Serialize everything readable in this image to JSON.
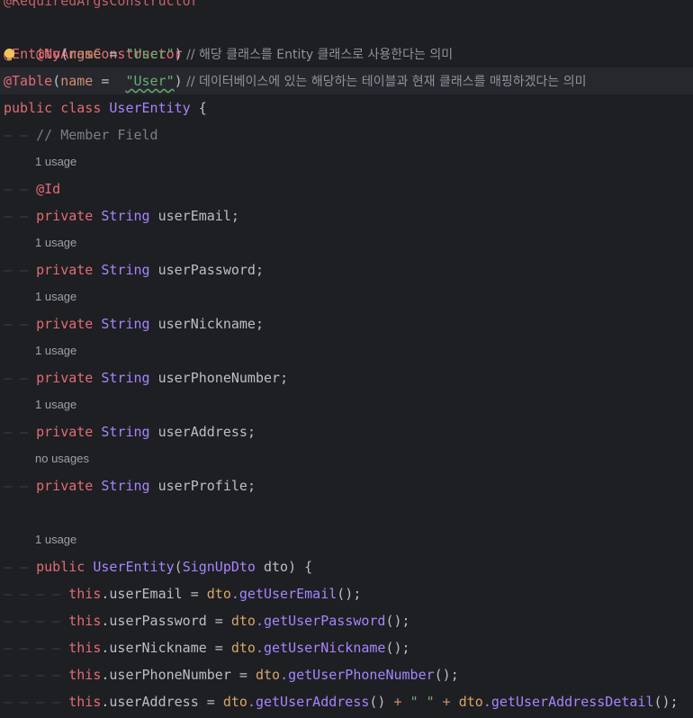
{
  "code": {
    "cut_top": "@RequiredArgsConstructor",
    "l1": {
      "ann": "@NoArgsConstructor"
    },
    "l2": {
      "ann": "@Entity",
      "open": "(",
      "key": "name",
      "eq": " = ",
      "val": "\"User\"",
      "close": ")",
      "comment": " // 해당 클래스를 Entity 클래스로 사용한다는 의미"
    },
    "l3": {
      "ann": "@Table",
      "open": "(",
      "key": "name",
      "eq": " =  ",
      "val": "\"User\"",
      "close": ")",
      "comment": " // 데이터베이스에 있는 해당하는 테이블과 현재 클래스를 매핑하겠다는 의미"
    },
    "l4": {
      "kw1": "public",
      "kw2": "class",
      "name": "UserEntity",
      "brace": " {"
    },
    "l5": {
      "comment": "// Member Field"
    },
    "usage_1": "1 usage",
    "usage_none": "no usages",
    "l6": {
      "ann": "@Id"
    },
    "fields": [
      {
        "mod": "private",
        "type": "String",
        "name": "userEmail",
        "semi": ";"
      },
      {
        "mod": "private",
        "type": "String",
        "name": "userPassword",
        "semi": ";"
      },
      {
        "mod": "private",
        "type": "String",
        "name": "userNickname",
        "semi": ";"
      },
      {
        "mod": "private",
        "type": "String",
        "name": "userPhoneNumber",
        "semi": ";"
      },
      {
        "mod": "private",
        "type": "String",
        "name": "userAddress",
        "semi": ";"
      },
      {
        "mod": "private",
        "type": "String",
        "name": "userProfile",
        "semi": ";"
      }
    ],
    "ctor": {
      "mod": "public",
      "name": "UserEntity",
      "open": "(",
      "ptype": "SignUpDto",
      "pname": "dto",
      "close": ")",
      "brace": " {"
    },
    "assign": [
      {
        "this": "this",
        "field": ".userEmail",
        "eq": " = ",
        "obj": "dto",
        "call": ".getUserEmail",
        "rest": "();"
      },
      {
        "this": "this",
        "field": ".userPassword",
        "eq": " = ",
        "obj": "dto",
        "call": ".getUserPassword",
        "rest": "();"
      },
      {
        "this": "this",
        "field": ".userNickname",
        "eq": " = ",
        "obj": "dto",
        "call": ".getUserNickname",
        "rest": "();"
      },
      {
        "this": "this",
        "field": ".userPhoneNumber",
        "eq": " = ",
        "obj": "dto",
        "call": ".getUserPhoneNumber",
        "rest": "();"
      }
    ],
    "assign_last": {
      "this": "this",
      "field": ".userAddress",
      "eq": " = ",
      "obj": "dto",
      "call": ".getUserAddress",
      "mid": "() ",
      "plus": "+",
      "sp": " ",
      "str": "\" \"",
      "plus2": " + ",
      "obj2": "dto",
      "call2": ".getUserAddressDetail",
      "rest": "();"
    }
  },
  "icons": {
    "intention": "lightbulb-icon"
  }
}
